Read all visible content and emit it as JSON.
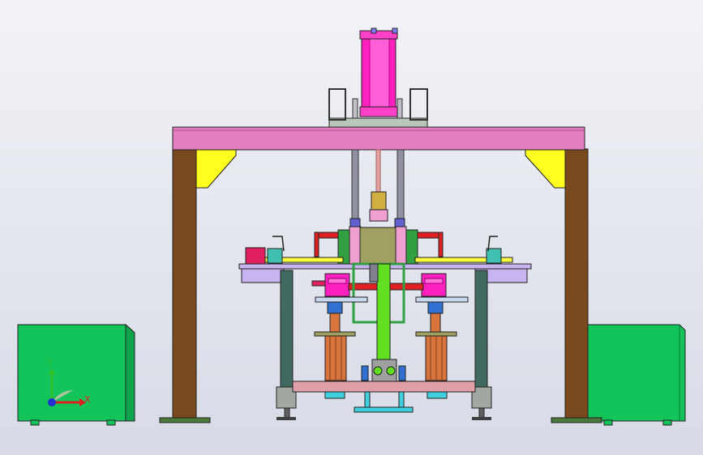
{
  "viewport": {
    "background_top": "#f2f3f7",
    "background_bottom": "#d7dbe6"
  },
  "triad": {
    "x_label": "X",
    "y_label": "Y",
    "x_color": "#e02020",
    "y_color": "#30c030",
    "z_color": "#2030d0"
  },
  "colors": {
    "frame_beam": "#e47fbf",
    "frame_post": "#7a4a1e",
    "gusset": "#ffff20",
    "cylinder": "#ff20c0",
    "cabinet": "#12c45a",
    "platform": "#c8b4f0",
    "carriage": "#a0a060",
    "side_block": "#30a040",
    "center_shaft": "#60e020",
    "red_bar": "#e02020",
    "spring": "#d8743c",
    "base_plate": "#e0a0a8",
    "cyan_part": "#40d0e0",
    "column": "#406a60"
  }
}
